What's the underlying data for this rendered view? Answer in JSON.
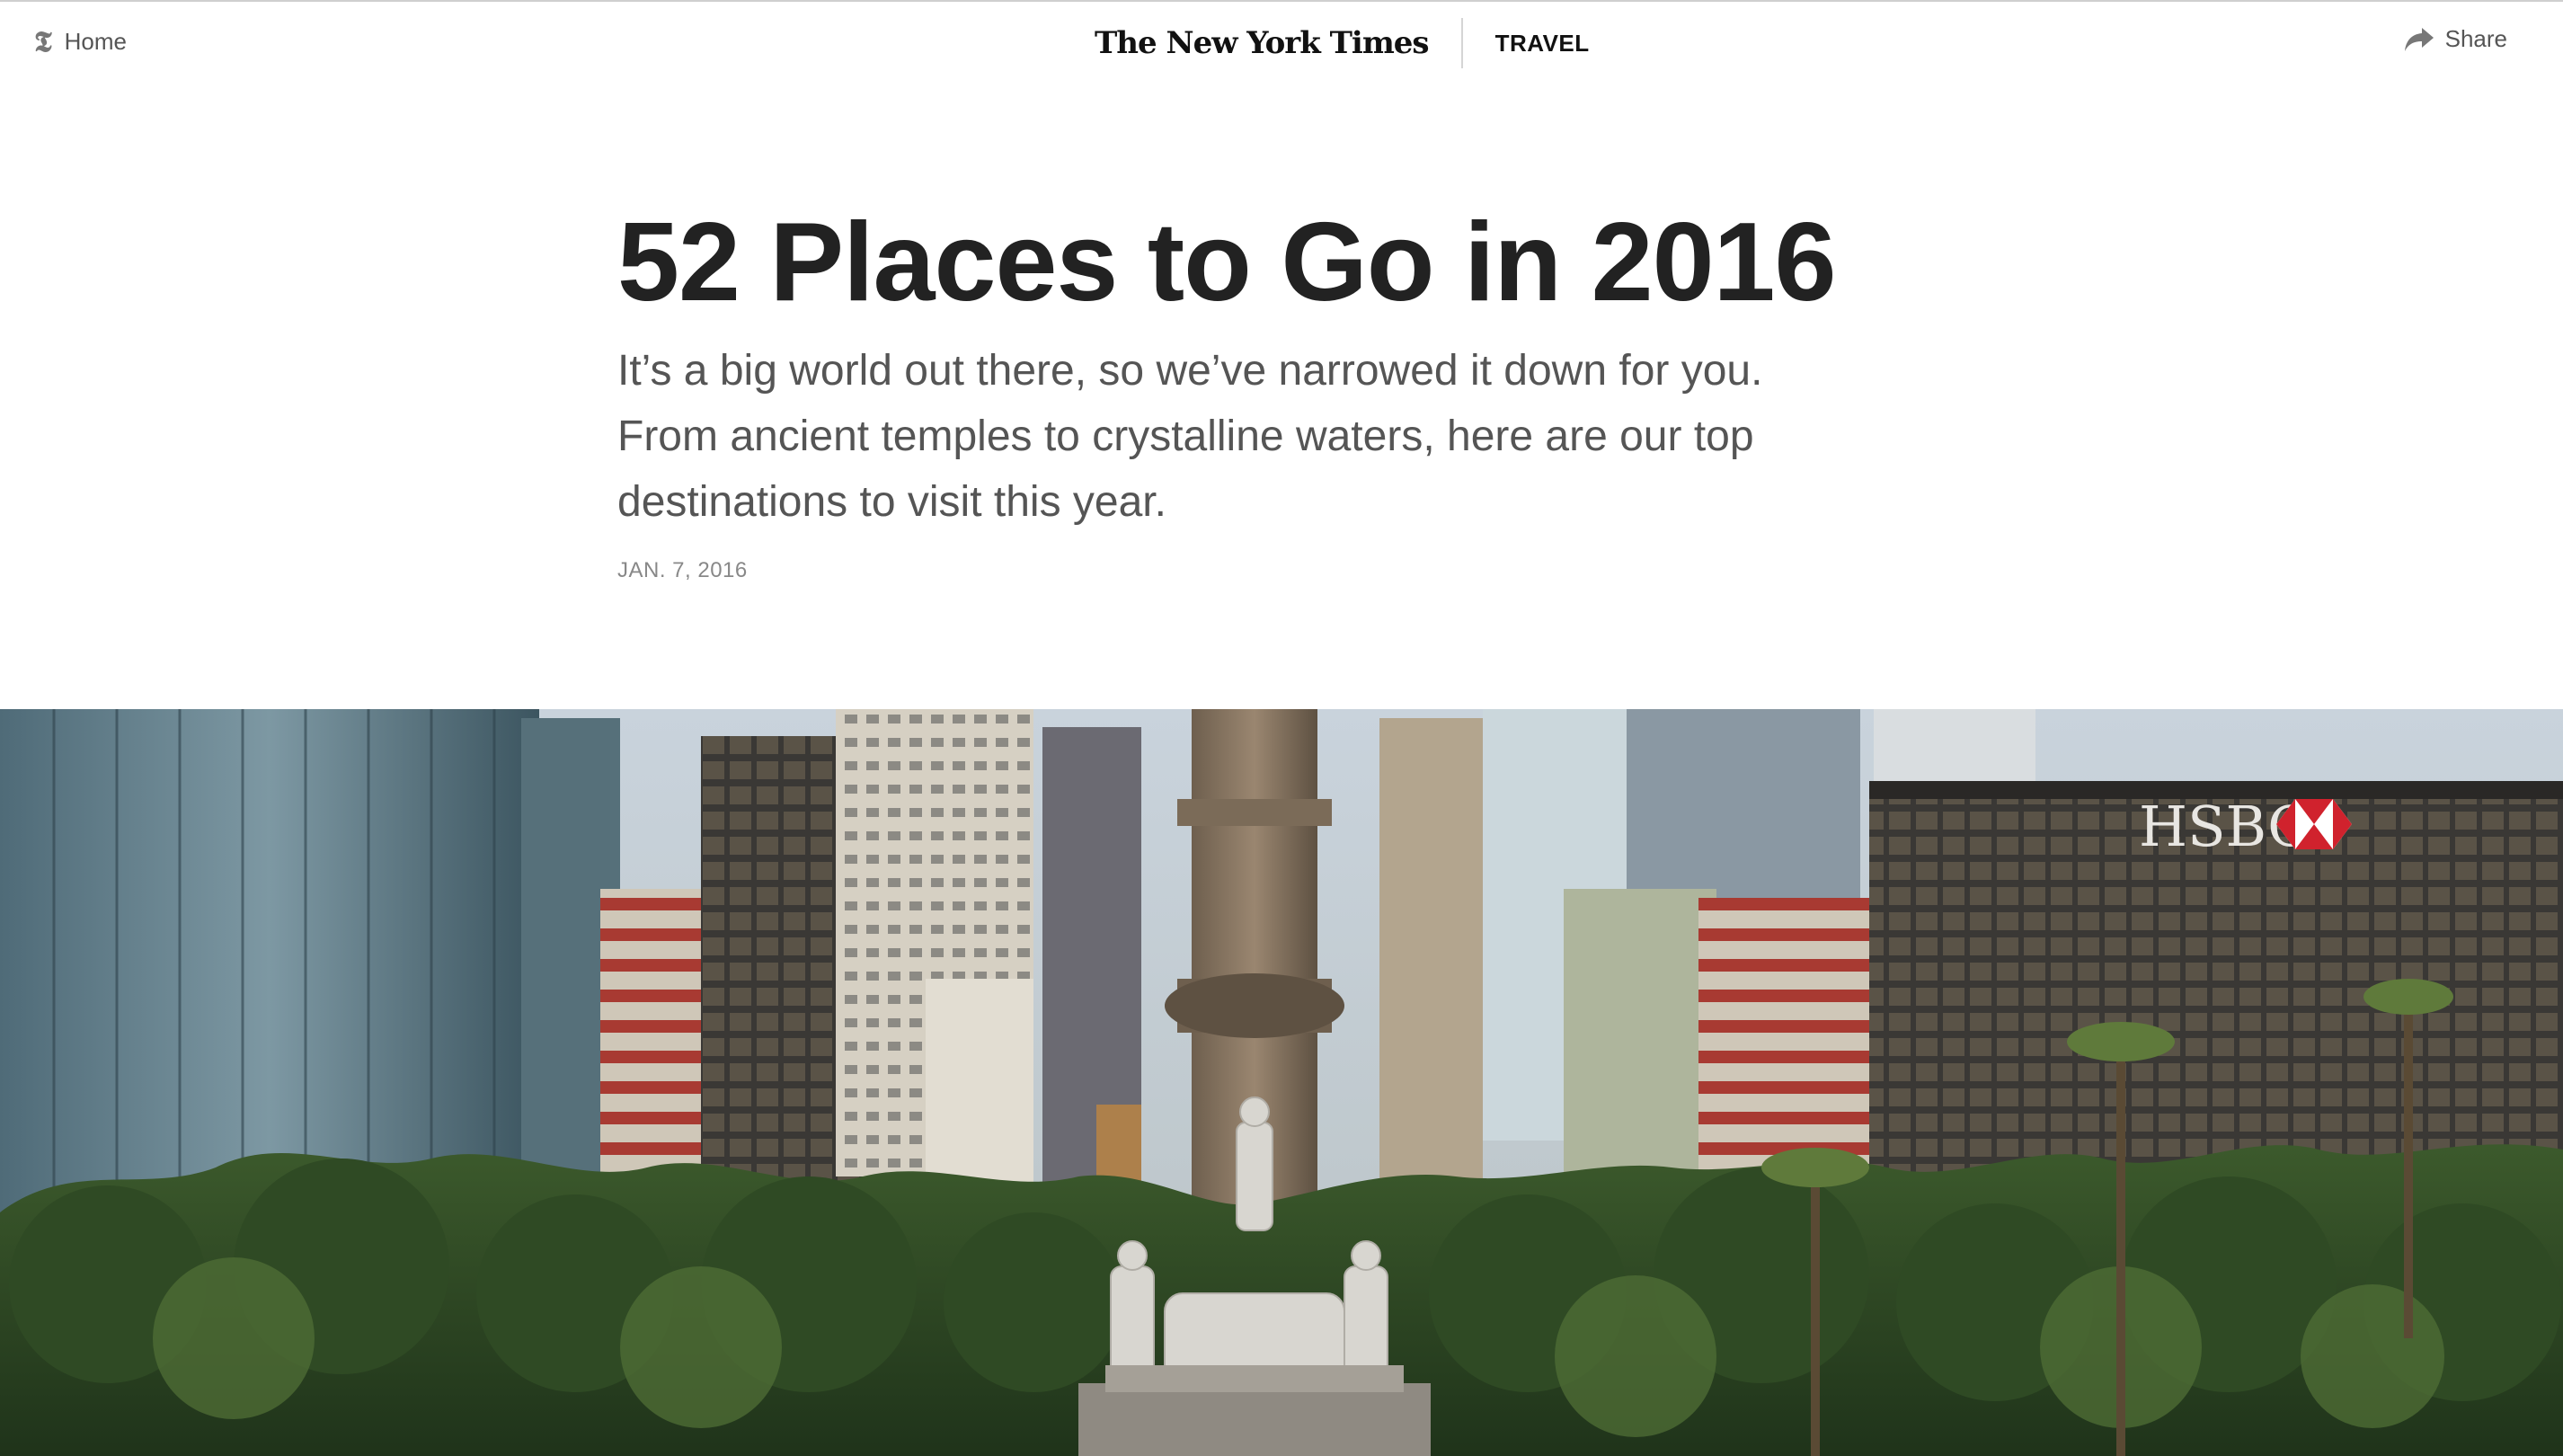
{
  "header": {
    "home_icon": "nyt-t-icon",
    "home_label": "Home",
    "logo_text": "The New York Times",
    "section": "TRAVEL",
    "share_icon": "share-arrow-icon",
    "share_label": "Share"
  },
  "article": {
    "headline": "52 Places to Go in 2016",
    "summary": "It’s a big world out there, so we’ve narrowed it down for you. From ancient temples to crystalline waters, here are our top destinations to visit this year.",
    "date": "JAN. 7, 2016"
  },
  "hero": {
    "sign_text": "HSBC"
  },
  "colors": {
    "headline": "#222222",
    "summary": "#555555",
    "meta": "#888888"
  }
}
